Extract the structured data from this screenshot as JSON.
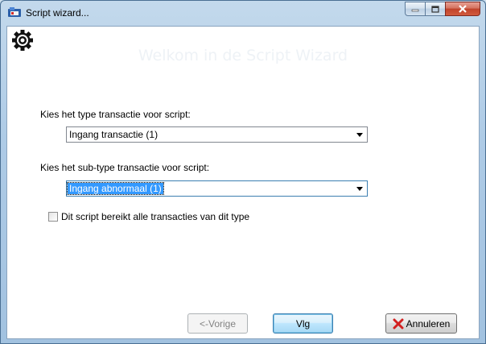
{
  "window": {
    "title": "Script wizard...",
    "controls": {
      "minimize": "minimize",
      "maximize": "maximize",
      "close": "close"
    }
  },
  "banner": {
    "title": "Welkom in de Script Wizard"
  },
  "form": {
    "type_label": "Kies het type transactie voor script:",
    "type_value": "Ingang transactie  (1)",
    "subtype_label": "Kies het sub-type transactie voor script:",
    "subtype_value": "Ingang abnormaal  (1)",
    "checkbox_label": "Dit script bereikt alle transacties van dit type",
    "checkbox_checked": false
  },
  "buttons": {
    "prev": "<-Vorige",
    "next": "Vlg",
    "cancel": "Annuleren"
  },
  "colors": {
    "accent": "#3399ff",
    "cancel_icon": "#d21f1f"
  }
}
